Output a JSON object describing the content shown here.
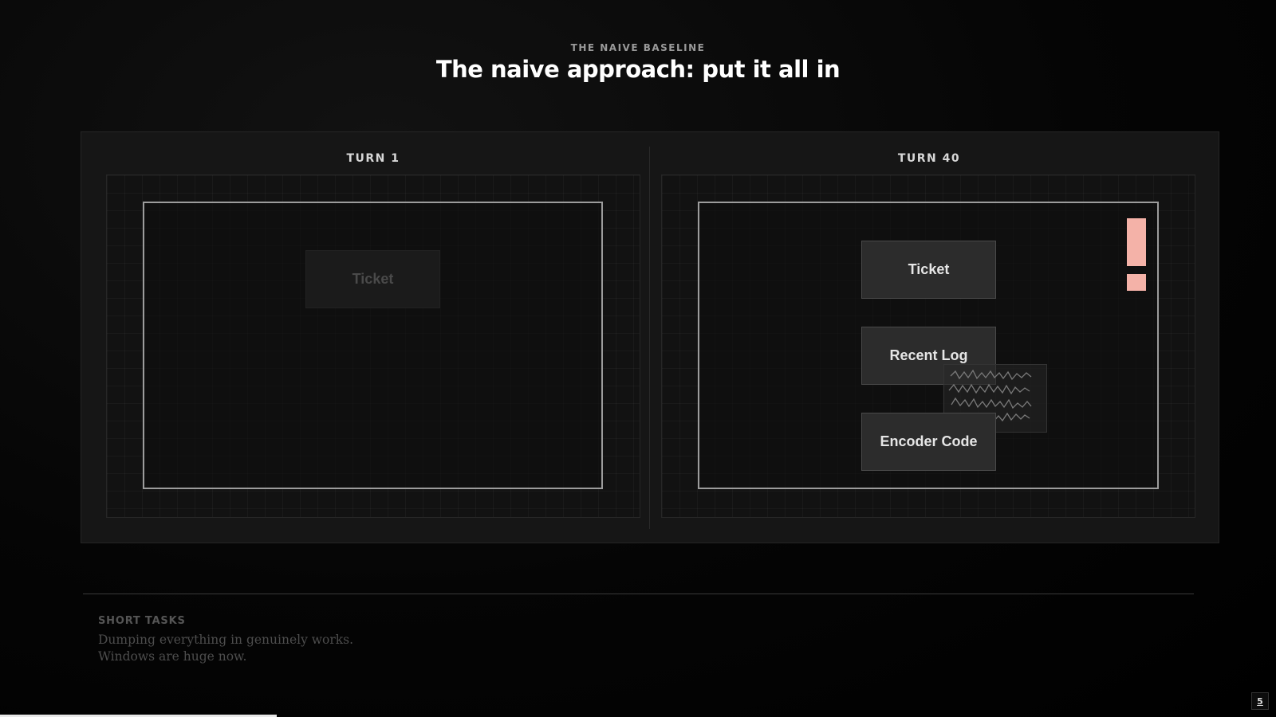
{
  "header": {
    "eyebrow": "THE NAIVE BASELINE",
    "title": "The naive approach: put it all in"
  },
  "panels": [
    {
      "label": "TURN 1",
      "blocks": [
        {
          "label": "Ticket",
          "state": "faded"
        }
      ]
    },
    {
      "label": "TURN 40",
      "blocks": [
        {
          "label": "Ticket",
          "state": "active"
        },
        {
          "label": "Recent Log",
          "state": "active"
        },
        {
          "label": "Encoder Code",
          "state": "active"
        }
      ]
    }
  ],
  "footnote": {
    "heading": "SHORT TASKS",
    "lines": [
      "Dumping everything in genuinely works.",
      "Windows are huge now."
    ]
  },
  "footer": {
    "page_number": "5"
  },
  "colors": {
    "warning": "#f4b2a8",
    "background": "#000000"
  },
  "icons": {
    "warning": "exclamation-icon",
    "noise": "scribble-icon"
  }
}
